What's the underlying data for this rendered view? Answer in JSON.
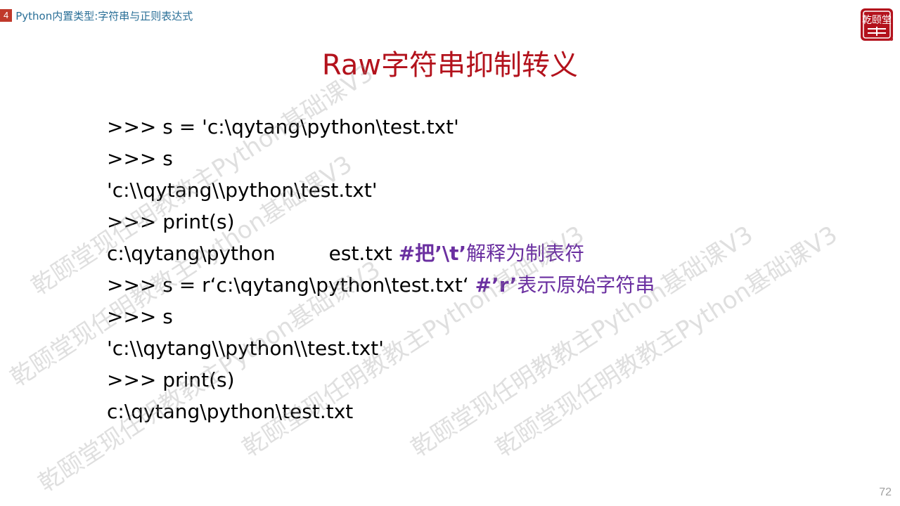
{
  "header": {
    "chapter_number": "4",
    "chapter_title": "Python内置类型:字符串与正则表达式"
  },
  "logo": {
    "icon": "qianyitang-seal-icon",
    "text": "乾颐堂",
    "color": "#b3121c"
  },
  "slide": {
    "title": "Raw字符串抑制转义",
    "title_color": "#b3121c",
    "comment_color": "#6a2fa0"
  },
  "code": {
    "line1": ">>> s = 'c:\\qytang\\python\\test.txt'",
    "line2": ">>> s",
    "line3": "'c:\\\\qytang\\\\python\\test.txt'",
    "line4": ">>> print(s)",
    "line5_a": "c:\\qytang\\python",
    "line5_b": "est.txt ",
    "line5_comment_a": "#把’\\t’",
    "line5_comment_b": "解释为制表符",
    "line6": ">>> s = r‘c:\\qytang\\python\\test.txt‘ ",
    "line6_comment_a": "#’r’",
    "line6_comment_b": "表示原始字符串",
    "line7": ">>> s",
    "line8": "'c:\\\\qytang\\\\python\\\\test.txt'",
    "line9": ">>> print(s)",
    "line10": "c:\\qytang\\python\\test.txt"
  },
  "watermark": {
    "text_a": "乾颐堂现任明教教主Python基础课V3",
    "text_b": "乾颐堂现任明教教主Python基础课V3",
    "text_c": "乾颐堂现任明教教主Python基础课V3",
    "text_d": "乾颐堂现任明教教主Python基础课V3",
    "text_e": "乾颐堂现任明教教主Python基础课V3",
    "text_f": "乾颐堂现任明教教主Python基础课V3"
  },
  "footer": {
    "page_number": "72"
  }
}
